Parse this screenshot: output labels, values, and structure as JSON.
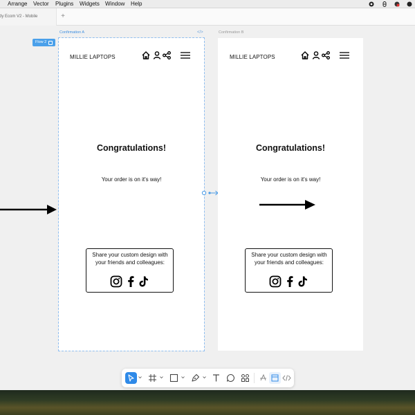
{
  "menubar": {
    "items": [
      "Arrange",
      "Vector",
      "Plugins",
      "Widgets",
      "Window",
      "Help"
    ]
  },
  "tabs": {
    "active": "dy Ecom V2 - Mobile",
    "add_label": "+"
  },
  "canvas": {
    "flow_badge": "Flow 2",
    "frame_a": {
      "label": "Confirmation A",
      "brand": "MILLIE LAPTOPS",
      "title": "Congratulations!",
      "subtitle": "Your order is on it's way!",
      "share_text": "Share your custom design with your friends and colleagues:"
    },
    "frame_b": {
      "label": "Confirmation B",
      "brand": "MILLIE LAPTOPS",
      "title": "Congratulations!",
      "subtitle": "Your order is on it's way!",
      "share_text": "Share your custom design with your friends and colleagues:"
    },
    "code_icon_text": "</>"
  },
  "colors": {
    "selection": "#8fbef0",
    "accent": "#2f8ae8",
    "badge": "#4aa0ea",
    "canvas": "#f0f0f0"
  },
  "icons": [
    "home-icon",
    "user-icon",
    "share-icon",
    "menu-icon",
    "instagram-icon",
    "facebook-icon",
    "tiktok-icon",
    "arrow-right-icon"
  ]
}
